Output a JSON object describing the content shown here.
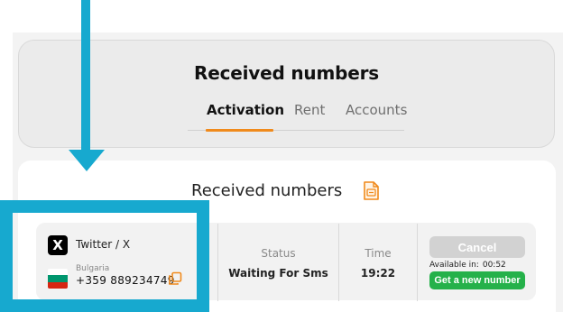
{
  "header": {
    "title": "Received numbers",
    "tabs": [
      {
        "label": "Activation",
        "active": true
      },
      {
        "label": "Rent",
        "active": false
      },
      {
        "label": "Accounts",
        "active": false
      }
    ]
  },
  "content": {
    "title": "Received numbers",
    "title_icon": "sms-document-icon"
  },
  "row": {
    "service_name": "Twitter / X",
    "service_logo": "X",
    "country": "Bulgaria",
    "country_flag_colors": [
      "#ffffff",
      "#00966e",
      "#d62612"
    ],
    "phone": "+359 889234749",
    "status_label": "Status",
    "status_value": "Waiting For Sms",
    "time_label": "Time",
    "time_value": "19:22",
    "cancel_label": "Cancel",
    "available_label": "Available in:",
    "available_value": "00:52",
    "new_number_label": "Get a new number"
  },
  "colors": {
    "accent_orange": "#f08a1c",
    "annotation_blue": "#17a9cf",
    "green_button": "#25b14a",
    "disabled_button": "#d2d2d2"
  }
}
